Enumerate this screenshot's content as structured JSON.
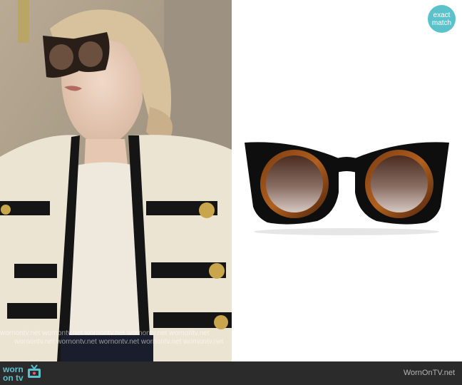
{
  "badge": {
    "line1": "exact",
    "line2": "match"
  },
  "watermark": "wornontv.net   wornontv.net   wornontv.net   wornontv.net   wornontv.net",
  "footer": {
    "logo_line1": "worn",
    "logo_line2": "on tv",
    "site": "WornOnTV.net"
  },
  "colors": {
    "accent": "#5bc2cb",
    "footer_bg": "#2b2b2b"
  },
  "icons": {
    "tv": "tv-icon"
  }
}
